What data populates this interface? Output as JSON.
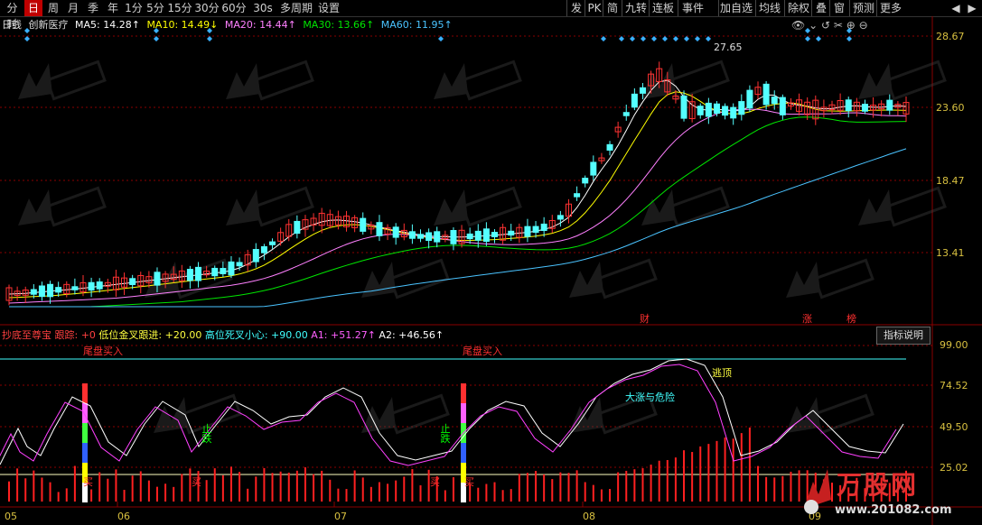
{
  "toolbar": {
    "left": [
      "分时",
      "日",
      "周",
      "月",
      "季",
      "年",
      "1分",
      "5分",
      "15分",
      "30分",
      "60分",
      "30s",
      "多周期",
      "设置"
    ],
    "selected": "日",
    "right": [
      "发",
      "PK",
      "简",
      "九转",
      "连板",
      "事件",
      "加自选",
      "均线",
      "除权",
      "叠",
      "窗",
      "预测",
      "更多"
    ]
  },
  "info": {
    "period": "日线",
    "stock": "创新医疗",
    "ma5": "MA5: 14.28↑",
    "ma10": "MA10: 14.49↓",
    "ma20": "MA20: 14.44↑",
    "ma30": "MA30: 13.66↑",
    "ma60": "MA60: 11.95↑"
  },
  "price_axis": [
    "28.67",
    "23.60",
    "18.47",
    "13.41"
  ],
  "high_marker": "27.65",
  "event_tags": [
    "财",
    "涨",
    "榜"
  ],
  "indicator": {
    "title": "抄底至尊宝",
    "track": "跟踪: +0",
    "low_cross": "低位金叉跟进: +20.00",
    "high_cross": "高位死叉小心: +90.00",
    "a1": "A1: +51.27↑",
    "a2": "A2: +46.56↑",
    "explain_button": "指标说明",
    "axis": [
      "99.00",
      "74.52",
      "49.50",
      "25.02"
    ],
    "labels": {
      "tail_buy_1": "尾盘买入",
      "tail_buy_2": "尾盘买入",
      "stop_fall_1": "止跌",
      "stop_fall_2": "止跌",
      "buy_1": "买",
      "buy_2": "买",
      "buy_3": "买",
      "buy_4": "买",
      "rise_risk": "大涨与危险",
      "escape_top": "逃顶"
    }
  },
  "x_axis": [
    "05",
    "06",
    "07",
    "08",
    "09"
  ],
  "watermark": {
    "brand": "万股网",
    "url": "www.201082.com"
  },
  "colors": {
    "up": "#ff3232",
    "down": "#54ffff",
    "ma5": "#ffffff",
    "ma10": "#ffff00",
    "ma20": "#ff80ff",
    "ma30": "#00e600",
    "ma60": "#4ac3ff"
  }
}
